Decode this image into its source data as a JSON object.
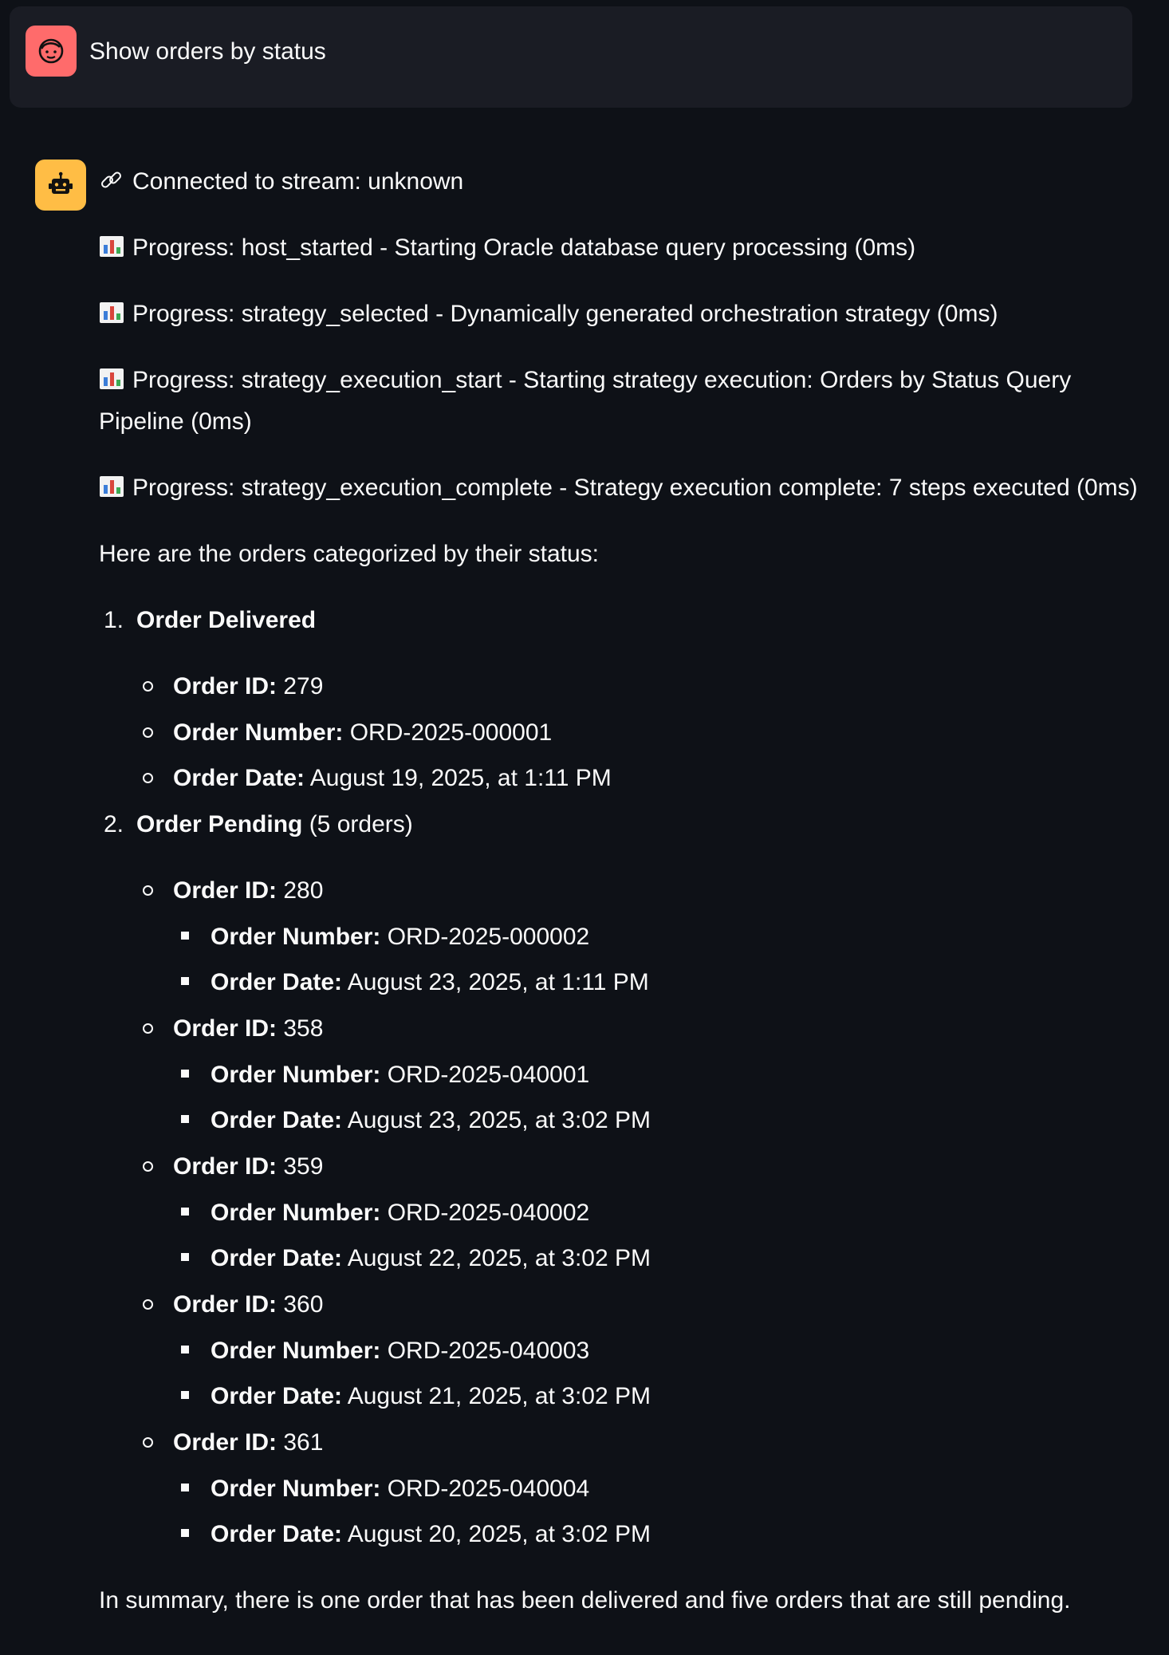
{
  "user_message": {
    "text": "Show orders by status",
    "avatar_icon": "user-face-icon",
    "avatar_color": "#ff6b6b"
  },
  "assistant_message": {
    "avatar_icon": "robot-icon",
    "avatar_color": "#ffbd45",
    "stream_line": "Connected to stream: unknown",
    "progress": [
      "Progress: host_started - Starting Oracle database query processing (0ms)",
      "Progress: strategy_selected - Dynamically generated orchestration strategy (0ms)",
      "Progress: strategy_execution_start - Starting strategy execution: Orders by Status Query Pipeline (0ms)",
      "Progress: strategy_execution_complete - Strategy execution complete: 7 steps executed (0ms)"
    ],
    "intro": "Here are the orders categorized by their status:",
    "labels": {
      "order_id": "Order ID:",
      "order_number": "Order Number:",
      "order_date": "Order Date:"
    },
    "delivered": {
      "num": "1.",
      "title": "Order Delivered",
      "order": {
        "id": " 279",
        "number": " ORD-2025-000001",
        "date": " August 19, 2025, at 1:11 PM"
      }
    },
    "pending": {
      "num": "2.",
      "title": "Order Pending",
      "count": " (5 orders)",
      "orders": [
        {
          "id": " 280",
          "number": " ORD-2025-000002",
          "date": " August 23, 2025, at 1:11 PM"
        },
        {
          "id": " 358",
          "number": " ORD-2025-040001",
          "date": " August 23, 2025, at 3:02 PM"
        },
        {
          "id": " 359",
          "number": " ORD-2025-040002",
          "date": " August 22, 2025, at 3:02 PM"
        },
        {
          "id": " 360",
          "number": " ORD-2025-040003",
          "date": " August 21, 2025, at 3:02 PM"
        },
        {
          "id": " 361",
          "number": " ORD-2025-040004",
          "date": " August 20, 2025, at 3:02 PM"
        }
      ]
    },
    "summary": "In summary, there is one order that has been delivered and five orders that are still pending."
  }
}
